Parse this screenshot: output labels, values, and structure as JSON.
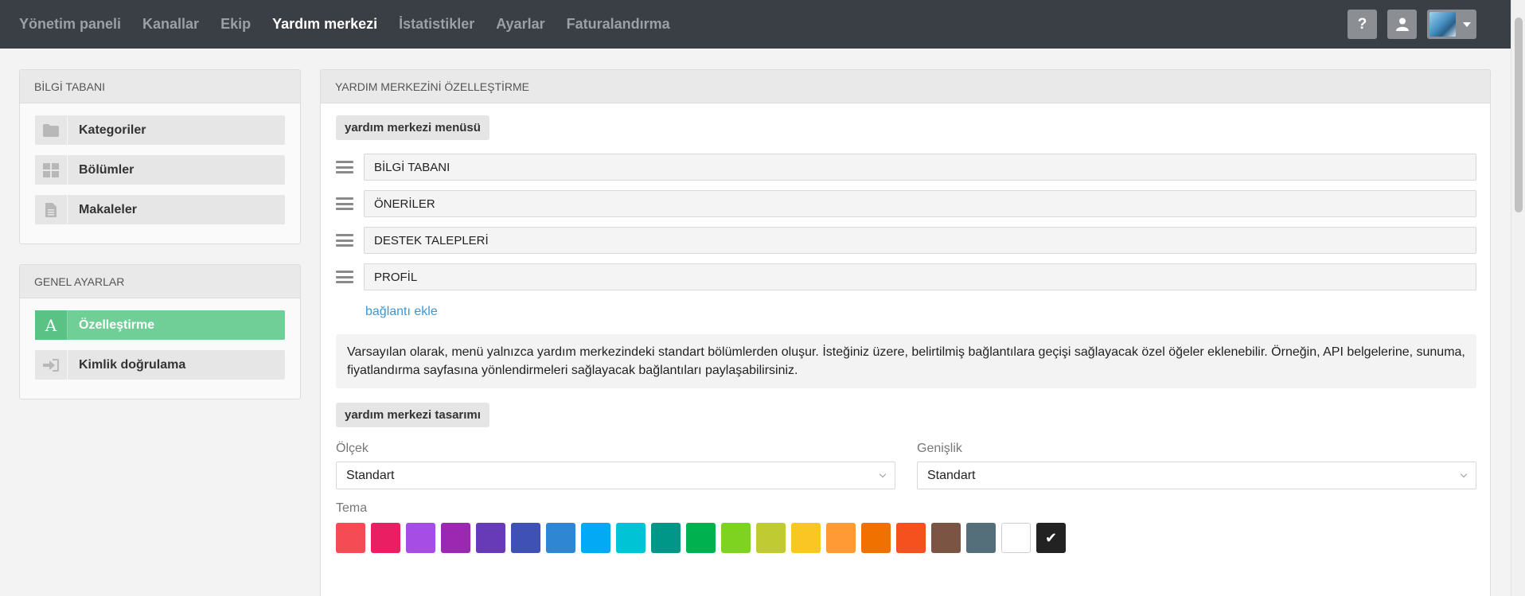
{
  "nav": {
    "items": [
      {
        "label": "Yönetim paneli",
        "active": false
      },
      {
        "label": "Kanallar",
        "active": false
      },
      {
        "label": "Ekip",
        "active": false
      },
      {
        "label": "Yardım merkezi",
        "active": true
      },
      {
        "label": "İstatistikler",
        "active": false
      },
      {
        "label": "Ayarlar",
        "active": false
      },
      {
        "label": "Faturalandırma",
        "active": false
      }
    ],
    "help_label": "?"
  },
  "sidebar": {
    "kb_title": "BİLGİ TABANI",
    "kb_items": [
      {
        "label": "Kategoriler",
        "icon": "folder-icon"
      },
      {
        "label": "Bölümler",
        "icon": "grid-icon"
      },
      {
        "label": "Makaleler",
        "icon": "document-icon"
      }
    ],
    "general_title": "GENEL AYARLAR",
    "general_items": [
      {
        "label": "Özelleştirme",
        "icon": "font-icon",
        "glyph": "A",
        "active": true
      },
      {
        "label": "Kimlik doğrulama",
        "icon": "sign-in-icon",
        "active": false
      }
    ]
  },
  "main": {
    "title": "YARDIM MERKEZİNİ ÖZELLEŞTİRME",
    "menu_section": "yardım merkezi menüsü",
    "menu_items": [
      "BİLGİ TABANI",
      "ÖNERİLER",
      "DESTEK TALEPLERİ",
      "PROFİL"
    ],
    "add_link": "bağlantı ekle",
    "info_text": "Varsayılan olarak, menü yalnızca yardım merkezindeki standart bölümlerden oluşur. İsteğiniz üzere, belirtilmiş bağlantılara geçişi sağlayacak özel öğeler eklenebilir. Örneğin, API belgelerine, sunuma, fiyatlandırma sayfasına yönlendirmeleri sağlayacak bağlantıları paylaşabilirsiniz.",
    "design_section": "yardım merkezi tasarımı",
    "scale": {
      "label": "Ölçek",
      "value": "Standart"
    },
    "width": {
      "label": "Genişlik",
      "value": "Standart"
    },
    "theme_label": "Tema",
    "theme_colors": [
      "#f44b54",
      "#e91e63",
      "#a64de6",
      "#9c27b0",
      "#673ab7",
      "#3f51b5",
      "#2f87d3",
      "#03a9f4",
      "#00c4d6",
      "#009688",
      "#00b14f",
      "#7ed321",
      "#c0ca33",
      "#f9c623",
      "#ff9a35",
      "#f07100",
      "#f4511e",
      "#7b5444",
      "#546e7a",
      "#ffffff",
      "#222222"
    ],
    "theme_selected_index": 20,
    "check_glyph": "✔"
  }
}
